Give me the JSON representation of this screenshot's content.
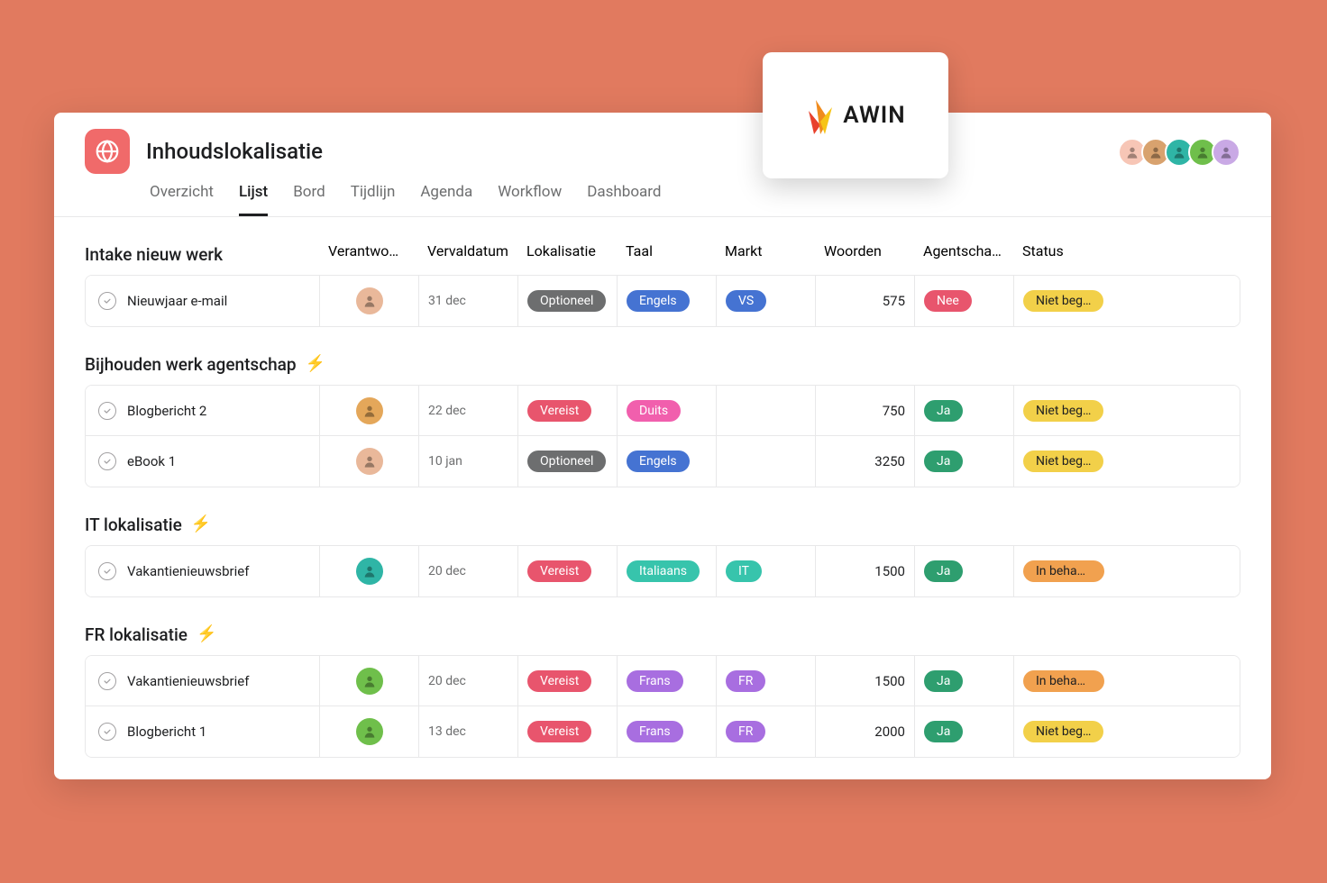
{
  "project": {
    "title": "Inhoudslokalisatie"
  },
  "tabs": [
    {
      "label": "Overzicht",
      "active": false
    },
    {
      "label": "Lijst",
      "active": true
    },
    {
      "label": "Bord",
      "active": false
    },
    {
      "label": "Tijdlijn",
      "active": false
    },
    {
      "label": "Agenda",
      "active": false
    },
    {
      "label": "Workflow",
      "active": false
    },
    {
      "label": "Dashboard",
      "active": false
    }
  ],
  "header_avatars": [
    {
      "bg": "#f7c6b6"
    },
    {
      "bg": "#d8a26e"
    },
    {
      "bg": "#2fb5a6"
    },
    {
      "bg": "#6fbf4b"
    },
    {
      "bg": "#c9a9e5"
    }
  ],
  "columns": [
    {
      "label": "Verantwo…"
    },
    {
      "label": "Vervaldatum"
    },
    {
      "label": "Lokalisatie"
    },
    {
      "label": "Taal"
    },
    {
      "label": "Markt"
    },
    {
      "label": "Woorden"
    },
    {
      "label": "Agentschap?"
    },
    {
      "label": "Status"
    }
  ],
  "pill_colors": {
    "optioneel": "#6d6e6f",
    "vereist": "#e8556d",
    "engels": "#4573d2",
    "duits": "#f15fad",
    "italiaans": "#37c4ac",
    "frans": "#a86ee0",
    "vs": "#4573d2",
    "it": "#37c4ac",
    "fr": "#a86ee0",
    "nee": "#e8556d",
    "ja": "#2e9e6f",
    "nietbeg": "#f2d049",
    "inbehan": "#f1a14f"
  },
  "sections": [
    {
      "title": "Intake nieuw werk",
      "bolt": false,
      "show_headers": true,
      "tasks": [
        {
          "name": "Nieuwjaar e-mail",
          "assignee_bg": "#e9b89a",
          "due": "31 dec",
          "lokalisatie": {
            "text": "Optioneel",
            "color_key": "optioneel"
          },
          "taal": {
            "text": "Engels",
            "color_key": "engels"
          },
          "markt": {
            "text": "VS",
            "color_key": "vs"
          },
          "woorden": "575",
          "agentschap": {
            "text": "Nee",
            "color_key": "nee"
          },
          "status": {
            "text": "Niet beg…",
            "color_key": "nietbeg",
            "dark": true
          }
        }
      ]
    },
    {
      "title": "Bijhouden werk agentschap",
      "bolt": true,
      "tasks": [
        {
          "name": "Blogbericht 2",
          "assignee_bg": "#e4a75a",
          "due": "22 dec",
          "lokalisatie": {
            "text": "Vereist",
            "color_key": "vereist"
          },
          "taal": {
            "text": "Duits",
            "color_key": "duits"
          },
          "markt": null,
          "woorden": "750",
          "agentschap": {
            "text": "Ja",
            "color_key": "ja"
          },
          "status": {
            "text": "Niet beg…",
            "color_key": "nietbeg",
            "dark": true
          }
        },
        {
          "name": "eBook 1",
          "assignee_bg": "#e9b89a",
          "due": "10 jan",
          "lokalisatie": {
            "text": "Optioneel",
            "color_key": "optioneel"
          },
          "taal": {
            "text": "Engels",
            "color_key": "engels"
          },
          "markt": null,
          "woorden": "3250",
          "agentschap": {
            "text": "Ja",
            "color_key": "ja"
          },
          "status": {
            "text": "Niet beg…",
            "color_key": "nietbeg",
            "dark": true
          }
        }
      ]
    },
    {
      "title": "IT lokalisatie",
      "bolt": true,
      "tasks": [
        {
          "name": "Vakantienieuwsbrief",
          "assignee_bg": "#2fb5a6",
          "due": "20 dec",
          "lokalisatie": {
            "text": "Vereist",
            "color_key": "vereist"
          },
          "taal": {
            "text": "Italiaans",
            "color_key": "italiaans"
          },
          "markt": {
            "text": "IT",
            "color_key": "it"
          },
          "woorden": "1500",
          "agentschap": {
            "text": "Ja",
            "color_key": "ja"
          },
          "status": {
            "text": "In behan…",
            "color_key": "inbehan",
            "dark": true
          }
        }
      ]
    },
    {
      "title": "FR lokalisatie",
      "bolt": true,
      "tasks": [
        {
          "name": "Vakantienieuwsbrief",
          "assignee_bg": "#6fbf4b",
          "due": "20 dec",
          "lokalisatie": {
            "text": "Vereist",
            "color_key": "vereist"
          },
          "taal": {
            "text": "Frans",
            "color_key": "frans"
          },
          "markt": {
            "text": "FR",
            "color_key": "fr"
          },
          "woorden": "1500",
          "agentschap": {
            "text": "Ja",
            "color_key": "ja"
          },
          "status": {
            "text": "In behan…",
            "color_key": "inbehan",
            "dark": true
          }
        },
        {
          "name": "Blogbericht 1",
          "assignee_bg": "#6fbf4b",
          "due": "13 dec",
          "lokalisatie": {
            "text": "Vereist",
            "color_key": "vereist"
          },
          "taal": {
            "text": "Frans",
            "color_key": "frans"
          },
          "markt": {
            "text": "FR",
            "color_key": "fr"
          },
          "woorden": "2000",
          "agentschap": {
            "text": "Ja",
            "color_key": "ja"
          },
          "status": {
            "text": "Niet beg…",
            "color_key": "nietbeg",
            "dark": true
          }
        }
      ]
    }
  ],
  "awin": {
    "text": "AWIN"
  }
}
